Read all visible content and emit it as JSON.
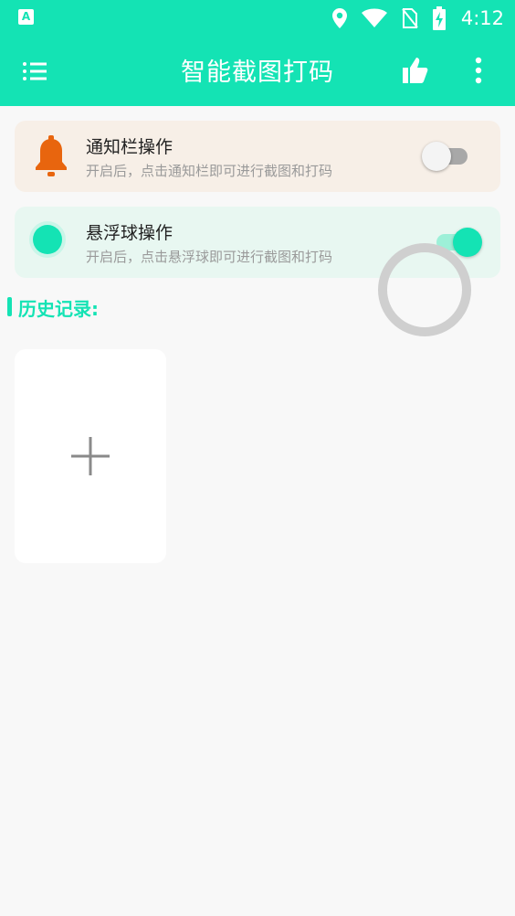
{
  "status_bar": {
    "app_indicator": "A",
    "time": "4:12",
    "icons": [
      "location-icon",
      "wifi-icon",
      "no-sim-icon",
      "battery-charging-icon"
    ]
  },
  "app_bar": {
    "title": "智能截图打码",
    "icons": [
      "menu-icon",
      "thumbs-up-icon",
      "more-vertical-icon"
    ]
  },
  "cards": {
    "notification": {
      "title": "通知栏操作",
      "subtitle": "开启后，点击通知栏即可进行截图和打码",
      "enabled": false,
      "icon": "bell-icon"
    },
    "floating_ball": {
      "title": "悬浮球操作",
      "subtitle": "开启后，点击悬浮球即可进行截图和打码",
      "enabled": true,
      "icon": "floating-ball-icon"
    }
  },
  "history": {
    "title": "历史记录:",
    "add_icon": "plus-icon"
  },
  "colors": {
    "accent": "#14e3b4",
    "bell": "#e8650e",
    "notify_card_bg": "#f7efe7",
    "float_card_bg": "#e8f7f1",
    "background": "#f8f8f8"
  }
}
